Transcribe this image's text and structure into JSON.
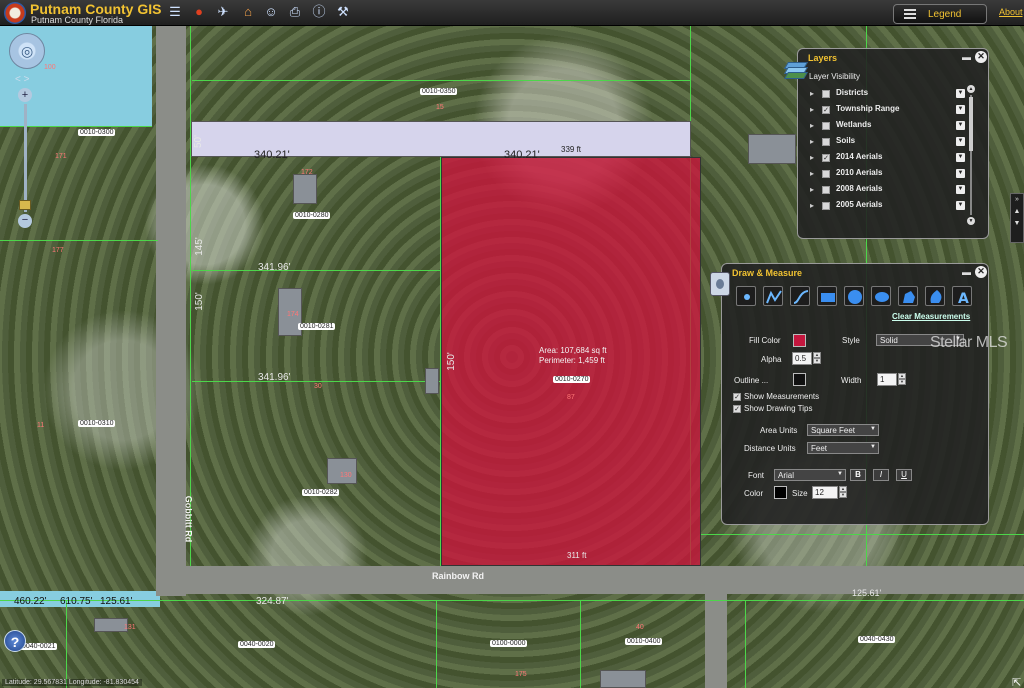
{
  "header": {
    "title": "Putnam County GIS",
    "subtitle": "Putnam County Florida",
    "legend_label": "Legend",
    "about_label": "About"
  },
  "toolbar": {
    "tools": [
      {
        "icon": "list-icon",
        "glyph": "☰"
      },
      {
        "icon": "stop-icon",
        "glyph": "●"
      },
      {
        "icon": "car-icon",
        "glyph": "✈"
      },
      {
        "icon": "home-icon",
        "glyph": "⌂"
      },
      {
        "icon": "search-person-icon",
        "glyph": "☺"
      },
      {
        "icon": "print-icon",
        "glyph": "⎙"
      },
      {
        "icon": "info-icon",
        "glyph": "ⓘ"
      },
      {
        "icon": "measure-icon",
        "glyph": "⚒"
      }
    ]
  },
  "layers_panel": {
    "title": "Layers",
    "visibility_label": "Layer Visibility",
    "layers": [
      {
        "name": "Districts",
        "checked": false
      },
      {
        "name": "Township Range",
        "checked": true
      },
      {
        "name": "Wetlands",
        "checked": false
      },
      {
        "name": "Soils",
        "checked": false
      },
      {
        "name": "2014 Aerials",
        "checked": true
      },
      {
        "name": "2010 Aerials",
        "checked": false
      },
      {
        "name": "2008 Aerials",
        "checked": false
      },
      {
        "name": "2005 Aerials",
        "checked": false
      }
    ]
  },
  "draw_panel": {
    "title": "Draw & Measure",
    "clear_label": "Clear Measurements",
    "fill_color_label": "Fill Color",
    "fill_color": "#c4173e",
    "style_label": "Style",
    "style_value": "Solid",
    "alpha_label": "Alpha",
    "alpha_value": "0.5",
    "outline_label": "Outline ...",
    "outline_color": "#111111",
    "width_label": "Width",
    "width_value": "1",
    "show_measurements_label": "Show Measurements",
    "show_drawing_tips_label": "Show Drawing Tips",
    "area_units_label": "Area Units",
    "area_units_value": "Square Feet",
    "distance_units_label": "Distance Units",
    "distance_units_value": "Feet",
    "font_label": "Font",
    "font_value": "Arial",
    "bold_label": "B",
    "italic_label": "I",
    "underline_label": "U",
    "color_label": "Color",
    "text_color": "#000000",
    "size_label": "Size",
    "size_value": "12"
  },
  "map": {
    "parcel_ids": [
      "0010-0350",
      "0010-0300",
      "0010-0280",
      "0010-0281",
      "0010-0270",
      "0010-0282",
      "0010-0310",
      "0100-0000",
      "0010-0400",
      "0040-0430",
      "0040-0020",
      "0040-0021"
    ],
    "parcel_numbers": [
      "15",
      "171",
      "172",
      "174",
      "30",
      "130",
      "87",
      "175",
      "177",
      "100",
      "131",
      "11",
      "40"
    ],
    "dimensions": [
      "340.21'",
      "340.21'",
      "339 ft",
      "341.96'",
      "341.96'",
      "50'",
      "150'",
      "145'",
      "150'",
      "460.22'",
      "610.75'",
      "125.61'",
      "324.87'",
      "125.61'",
      "311 ft"
    ],
    "road_names": [
      "Rainbow Rd",
      "Gobbitt Rd"
    ],
    "area_label": "Area: 107,684 sq ft",
    "perimeter_label": "Perimeter: 1,459 ft"
  },
  "status": {
    "coords": "Latitude: 29.567831  Longitude: -81.830454"
  },
  "watermark": "Stellar MLS"
}
